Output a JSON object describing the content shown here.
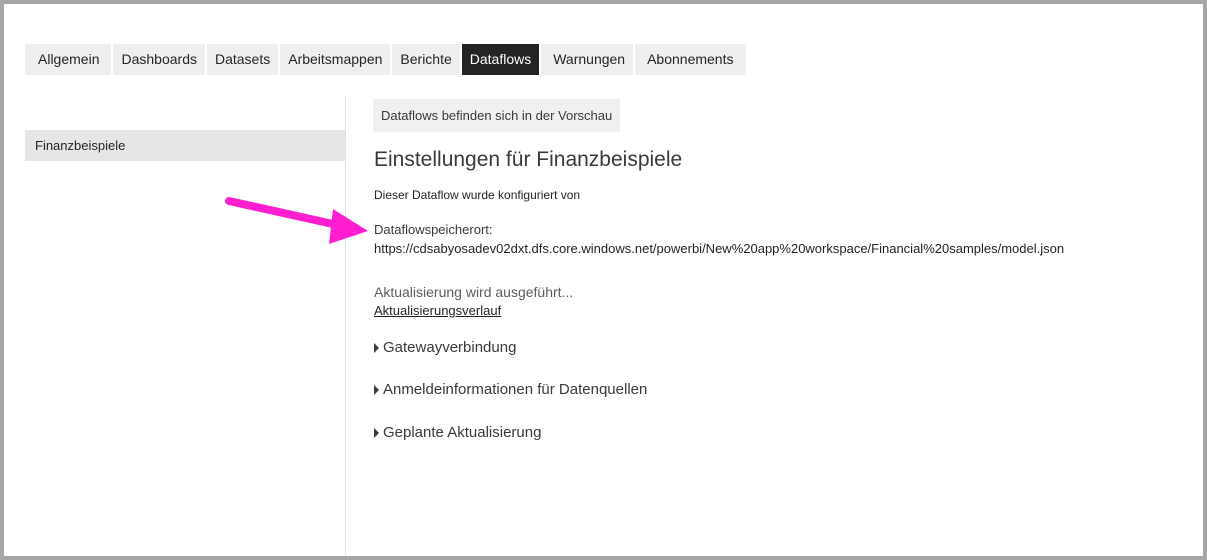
{
  "tabs": [
    {
      "label": "Allgemein",
      "active": false
    },
    {
      "label": "Dashboards",
      "active": false
    },
    {
      "label": "Datasets",
      "active": false
    },
    {
      "label": "Arbeitsmappen",
      "active": false
    },
    {
      "label": "Berichte",
      "active": false
    },
    {
      "label": "Dataflows",
      "active": true
    },
    {
      "label": "Warnungen",
      "active": false
    },
    {
      "label": "Abonnements",
      "active": false
    }
  ],
  "sidebar": {
    "items": [
      {
        "label": "Finanzbeispiele",
        "selected": true
      }
    ]
  },
  "main": {
    "preview_badge": "Dataflows befinden sich in der Vorschau",
    "title": "Einstellungen für Finanzbeispiele",
    "configured_by": "Dieser Dataflow wurde konfiguriert von",
    "storage_label": "Dataflowspeicherort:",
    "storage_value": "https://cdsabyosadev02dxt.dfs.core.windows.net/powerbi/New%20app%20workspace/Financial%20samples/model.json",
    "refresh_status": "Aktualisierung wird ausgeführt...",
    "refresh_history": "Aktualisierungsverlauf",
    "sections": [
      {
        "label": "Gatewayverbindung",
        "icon": "caret-right-icon"
      },
      {
        "label": "Anmeldeinformationen für Datenquellen",
        "icon": "caret-right-icon"
      },
      {
        "label": "Geplante Aktualisierung",
        "icon": "caret-right-icon"
      }
    ]
  },
  "colors": {
    "active_tab_bg": "#252423",
    "tab_bg": "#efefef",
    "sidebar_selected_bg": "#e6e6e6",
    "annotation_arrow": "#ff1fd1"
  }
}
